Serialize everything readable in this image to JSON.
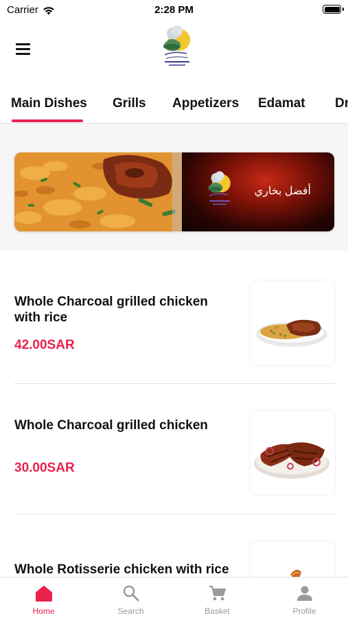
{
  "status_bar": {
    "carrier": "Carrier",
    "time": "2:28 PM"
  },
  "header": {
    "logo_icon": "restaurant-chef-logo",
    "menu_icon": "hamburger-menu-icon"
  },
  "categories": {
    "active_index": 0,
    "tabs": [
      {
        "label": "Main Dishes"
      },
      {
        "label": "Grills"
      },
      {
        "label": "Appetizers"
      },
      {
        "label": "Edamat"
      },
      {
        "label": "Dr"
      }
    ]
  },
  "banner": {
    "text": "أفضل بخاري"
  },
  "menu_items": [
    {
      "name": "Whole Charcoal grilled chicken with rice",
      "price": "42.00SAR"
    },
    {
      "name": "Whole Charcoal grilled chicken",
      "price": "30.00SAR"
    },
    {
      "name": "Whole Rotisserie chicken with rice",
      "price": ""
    }
  ],
  "tab_bar": {
    "items": [
      {
        "label": "Home",
        "icon": "home-icon",
        "active": true
      },
      {
        "label": "Search",
        "icon": "search-icon",
        "active": false
      },
      {
        "label": "Basket",
        "icon": "cart-icon",
        "active": false
      },
      {
        "label": "Profile",
        "icon": "person-icon",
        "active": false
      }
    ]
  },
  "colors": {
    "accent": "#e8224d",
    "inactive": "#9a9a9a",
    "text": "#111111"
  }
}
